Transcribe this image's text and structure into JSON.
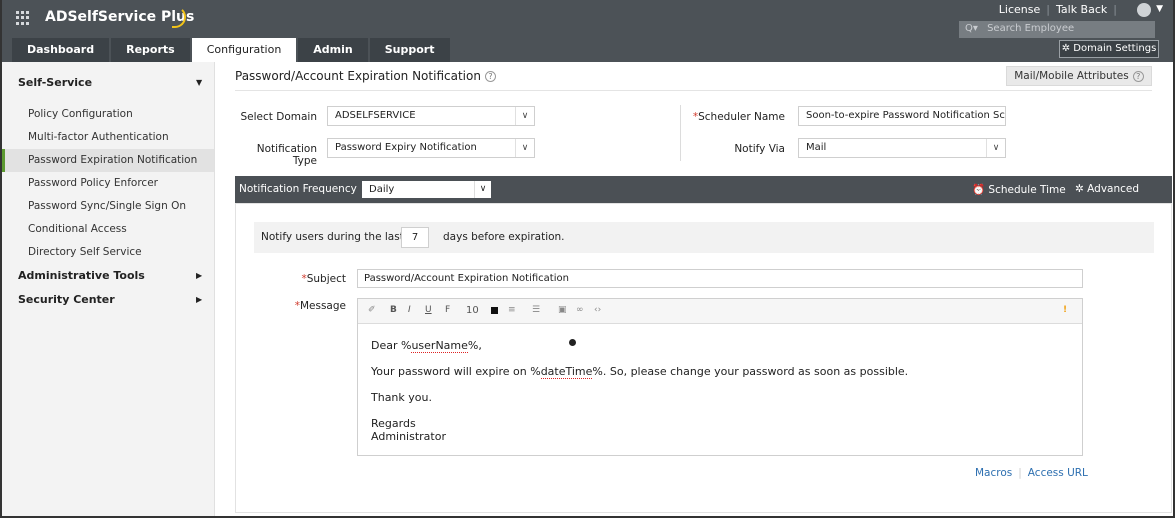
{
  "app": {
    "title": "ADSelfService Plus",
    "links": [
      "License",
      "Talk Back"
    ],
    "search_placeholder": "Search Employee",
    "domain_settings": "Domain Settings",
    "accent": "#4c5257",
    "brand_arc_color": "#f2c318"
  },
  "tabs": [
    {
      "label": "Dashboard",
      "active": false
    },
    {
      "label": "Reports",
      "active": false
    },
    {
      "label": "Configuration",
      "active": true
    },
    {
      "label": "Admin",
      "active": false
    },
    {
      "label": "Support",
      "active": false
    }
  ],
  "sidebar": {
    "sections": [
      {
        "label": "Self-Service",
        "expanded": true,
        "items": [
          {
            "label": "Policy Configuration",
            "active": false
          },
          {
            "label": "Multi-factor Authentication",
            "active": false
          },
          {
            "label": "Password Expiration Notification",
            "active": true
          },
          {
            "label": "Password Policy Enforcer",
            "active": false
          },
          {
            "label": "Password Sync/Single Sign On",
            "active": false
          },
          {
            "label": "Conditional Access",
            "active": false
          },
          {
            "label": "Directory Self Service",
            "active": false
          }
        ]
      },
      {
        "label": "Administrative Tools",
        "expanded": false
      },
      {
        "label": "Security Center",
        "expanded": false
      }
    ]
  },
  "page": {
    "title": "Password/Account Expiration Notification",
    "mail_attr_button": "Mail/Mobile Attributes"
  },
  "form": {
    "select_domain_label": "Select Domain",
    "select_domain_value": "ADSELFSERVICE",
    "notification_type_label": "Notification Type",
    "notification_type_value": "Password Expiry Notification",
    "scheduler_name_label": "Scheduler Name",
    "scheduler_name_value": "Soon-to-expire Password Notification Scl",
    "notify_via_label": "Notify Via",
    "notify_via_value": "Mail"
  },
  "frequency": {
    "label": "Notification Frequency",
    "value": "Daily",
    "schedule_time": "Schedule Time",
    "advanced": "Advanced"
  },
  "notify": {
    "prefix": "Notify users during the last",
    "days": "7",
    "suffix": "days before expiration."
  },
  "message": {
    "subject_label": "Subject",
    "subject_value": "Password/Account Expiration Notification",
    "message_label": "Message",
    "toolbar_font_size": "10",
    "body": {
      "greeting_pre": "Dear %",
      "greeting_var": "userName",
      "greeting_post": "%,",
      "line2_pre": "Your password will expire on %",
      "line2_var": "dateTime",
      "line2_post": "%. So, please change your password as soon as possible.",
      "thanks": "Thank you.",
      "regards": "Regards",
      "signature": "Administrator"
    },
    "macros_link": "Macros",
    "access_url_link": "Access URL"
  }
}
